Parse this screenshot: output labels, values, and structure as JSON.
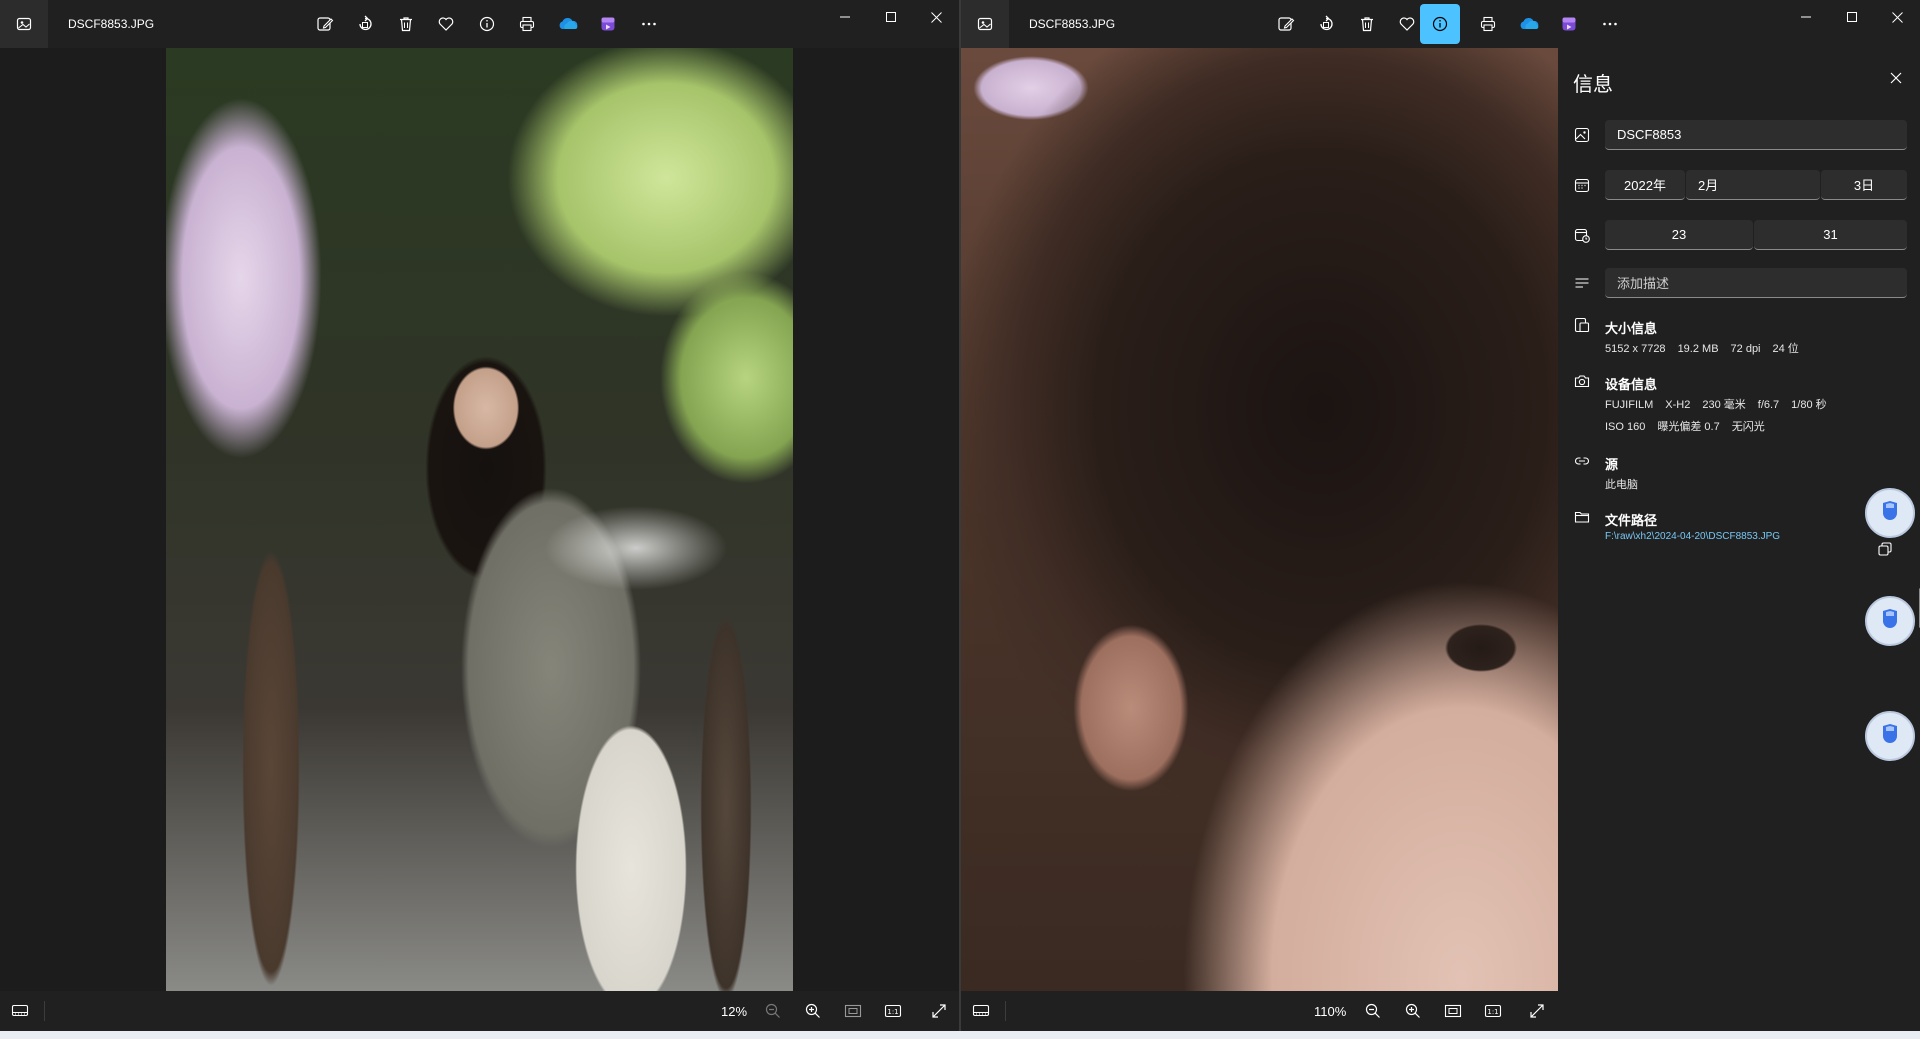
{
  "left_window": {
    "title": "DSCF8853.JPG",
    "toolbar": [
      "edit-icon",
      "rotate-icon",
      "delete-icon",
      "favorite-icon",
      "info-icon",
      "print-icon",
      "onedrive-icon",
      "clipchamp-icon",
      "more-icon"
    ],
    "zoom": "12%"
  },
  "right_window": {
    "title": "DSCF8853.JPG",
    "toolbar": [
      "edit-icon",
      "rotate-icon",
      "delete-icon",
      "favorite-icon",
      "info-icon",
      "print-icon",
      "onedrive-icon",
      "clipchamp-icon",
      "more-icon"
    ],
    "active_tool": "info-icon",
    "zoom": "110%"
  },
  "info": {
    "title": "信息",
    "name": "DSCF8853",
    "date": {
      "year": "2022年",
      "month": "2月",
      "day": "3日"
    },
    "time": {
      "hour": "23",
      "minute": "31"
    },
    "description_placeholder": "添加描述",
    "size_title": "大小信息",
    "size": {
      "dimensions": "5152 x 7728",
      "filesize": "19.2 MB",
      "dpi": "72 dpi",
      "bits": "24 位"
    },
    "device_title": "设备信息",
    "device": {
      "make": "FUJIFILM",
      "model": "X-H2",
      "focal": "230 毫米",
      "aperture": "f/6.7",
      "shutter": "1/80 秒",
      "iso": "ISO 160",
      "exposure": "曝光偏差 0.7",
      "flash": "无闪光"
    },
    "source_title": "源",
    "source": "此电脑",
    "path_title": "文件路径",
    "path": "F:\\raw\\xh2\\2024-04-20\\DSCF8853.JPG"
  },
  "colors": {
    "accent": "#4cc2ff",
    "link": "#78c8f5",
    "background": "#202020"
  }
}
